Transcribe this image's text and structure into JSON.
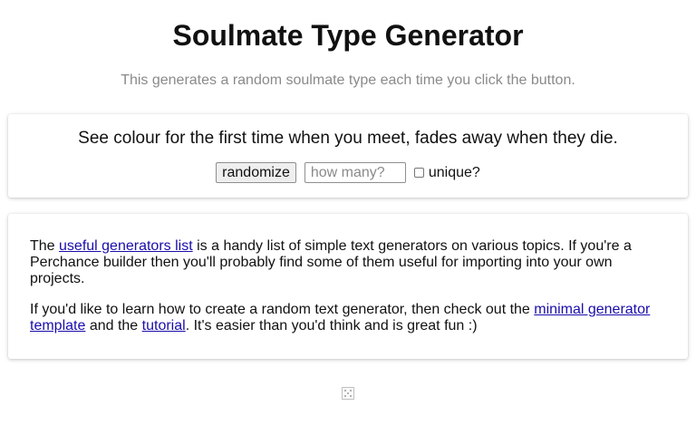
{
  "header": {
    "title": "Soulmate Type Generator",
    "subtitle": "This generates a random soulmate type each time you click the button."
  },
  "generator": {
    "output_text": "See colour for the first time when you meet, fades away when they die.",
    "randomize_label": "randomize",
    "count_placeholder": "how many?",
    "count_value": "",
    "unique_label": "unique?",
    "unique_checked": false
  },
  "info": {
    "p1_before": "The ",
    "p1_link": "useful generators list",
    "p1_after": " is a handy list of simple text generators on various topics. If you're a Perchance builder then you'll probably find some of them useful for importing into your own projects.",
    "p2_before": "If you'd like to learn how to create a random text generator, then check out the ",
    "p2_link1": "minimal generator template",
    "p2_middle": " and the ",
    "p2_link2": "tutorial",
    "p2_after": ". It's easier than you'd think and is great fun :)"
  },
  "footer": {
    "icon": "dice-icon"
  },
  "colors": {
    "link": "#1a0dab",
    "subtitle": "#8a8a8a"
  }
}
